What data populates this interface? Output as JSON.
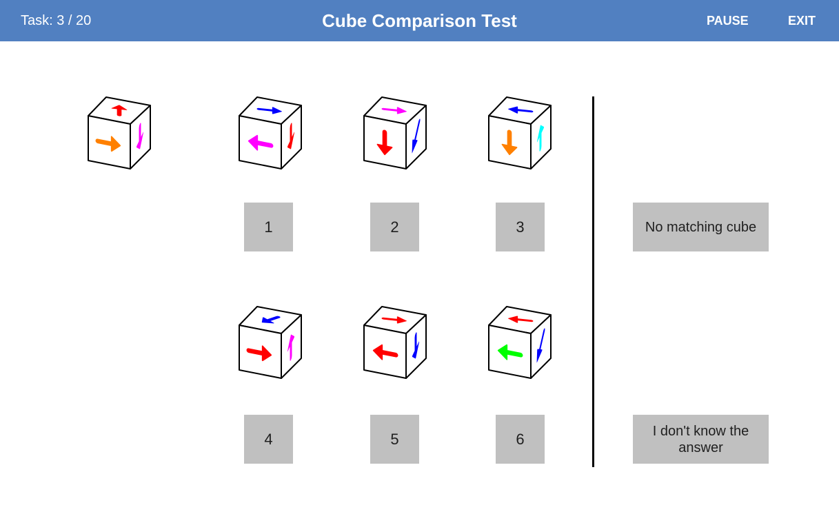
{
  "header": {
    "task_label": "Task: 3 / 20",
    "title": "Cube Comparison Test",
    "pause_label": "PAUSE",
    "exit_label": "EXIT",
    "bar_color": "#5180c1"
  },
  "reference_cube": {
    "top": {
      "color": "#ff0000",
      "dir": "up"
    },
    "front": {
      "color": "#ff8000",
      "dir": "right"
    },
    "side": {
      "color": "#ff00ff",
      "dir": "down"
    }
  },
  "options": [
    {
      "label": "1",
      "top": {
        "color": "#0000ff",
        "dir": "right"
      },
      "front": {
        "color": "#ff00ff",
        "dir": "left"
      },
      "side": {
        "color": "#ff0000",
        "dir": "down"
      }
    },
    {
      "label": "2",
      "top": {
        "color": "#ff00ff",
        "dir": "right"
      },
      "front": {
        "color": "#ff0000",
        "dir": "down"
      },
      "side": {
        "color": "#0000ff",
        "dir": "downleft"
      }
    },
    {
      "label": "3",
      "top": {
        "color": "#0000ff",
        "dir": "left"
      },
      "front": {
        "color": "#ff8000",
        "dir": "down"
      },
      "side": {
        "color": "#00ffff",
        "dir": "up"
      }
    },
    {
      "label": "4",
      "top": {
        "color": "#0000ff",
        "dir": "downleft"
      },
      "front": {
        "color": "#ff0000",
        "dir": "right"
      },
      "side": {
        "color": "#ff00ff",
        "dir": "up"
      }
    },
    {
      "label": "5",
      "top": {
        "color": "#ff0000",
        "dir": "right"
      },
      "front": {
        "color": "#ff0000",
        "dir": "left"
      },
      "side": {
        "color": "#0000ff",
        "dir": "down"
      }
    },
    {
      "label": "6",
      "top": {
        "color": "#ff0000",
        "dir": "left"
      },
      "front": {
        "color": "#00ff00",
        "dir": "left"
      },
      "side": {
        "color": "#0000ff",
        "dir": "downleft"
      }
    }
  ],
  "no_match_label": "No matching cube",
  "dont_know_label": "I don't know the answer",
  "button_color": "#c0c0c0"
}
